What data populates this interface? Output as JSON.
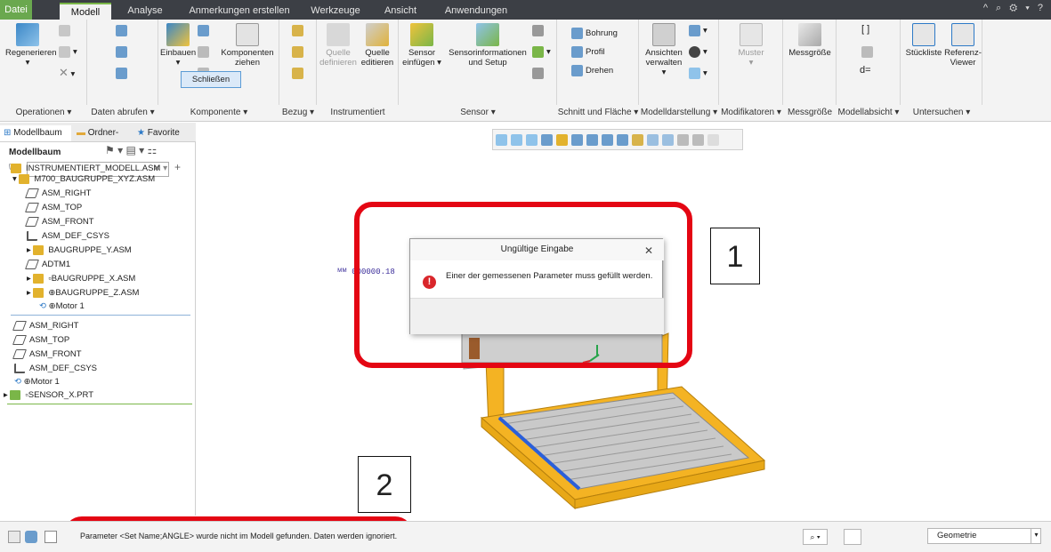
{
  "tabs": [
    "Datei",
    "Modell",
    "Analyse",
    "Anmerkungen erstellen",
    "Werkzeuge",
    "Ansicht",
    "Anwendungen"
  ],
  "quick_access": "^ ⌕ ⚙ ▾ ?",
  "ribbon": {
    "buttons": {
      "regenerieren": "Regenerieren",
      "einbauen": "Einbauen",
      "komponenten_ziehen_1": "Komponenten",
      "komponenten_ziehen_2": "ziehen",
      "quelle_def_1": "Quelle",
      "quelle_def_2": "definieren",
      "quelle_edit_1": "Quelle",
      "quelle_edit_2": "editieren",
      "sensor_einf_1": "Sensor",
      "sensor_einf_2": "einfügen ▾",
      "sensorinfo_1": "Sensorinformationen",
      "sensorinfo_2": "und Setup",
      "bohrung": "Bohrung",
      "profil": "Profil",
      "drehen": "Drehen",
      "ansichten_1": "Ansichten",
      "ansichten_2": "verwalten ▾",
      "muster": "Muster",
      "messgroesse": "Messgröße",
      "d_eq": "d=",
      "stueckliste": "Stückliste",
      "referenz_1": "Referenz-",
      "referenz_2": "Viewer"
    },
    "groups": [
      "Operationen ▾",
      "Daten abrufen ▾",
      "Komponente ▾",
      "Bezug ▾",
      "Instrumentiert",
      "Sensor ▾",
      "Schnitt und Fläche ▾",
      "Modelldarstellung ▾",
      "Modifikatoren ▾",
      "Messgröße",
      "Modellabsicht ▾",
      "Untersuchen ▾"
    ]
  },
  "left_panel": {
    "tabs": [
      "Modellbaum",
      "Ordner-",
      "Favorite"
    ],
    "header": "Modellbaum",
    "tree": [
      "INSTRUMENTIERT_MODELL.ASM",
      "M700_BAUGRUPPE_XYZ.ASM",
      "ASM_RIGHT",
      "ASM_TOP",
      "ASM_FRONT",
      "ASM_DEF_CSYS",
      "BAUGRUPPE_Y.ASM",
      "ADTM1",
      "BAUGRUPPE_X.ASM",
      "BAUGRUPPE_Z.ASM",
      "Motor 1"
    ],
    "tree2": [
      "ASM_RIGHT",
      "ASM_TOP",
      "ASM_FRONT",
      "ASM_DEF_CSYS",
      "Motor 1",
      "SENSOR_X.PRT"
    ]
  },
  "model_label": "ᴹᴹ 000000.18",
  "dialog": {
    "title": "Ungültige Eingabe",
    "message": "Einer der gemessenen Parameter muss gefüllt werden.",
    "button": "Schließen"
  },
  "callouts": [
    "1",
    "2"
  ],
  "status": {
    "message": "Parameter <Set Name;ANGLE> wurde nicht im Modell gefunden. Daten werden ignoriert.",
    "filter_value": "Geometrie"
  },
  "colors": {
    "highlight": "#e40613",
    "tabbar": "#3c3f45",
    "frame": "#f4b323",
    "accent_green": "#7ab648"
  }
}
